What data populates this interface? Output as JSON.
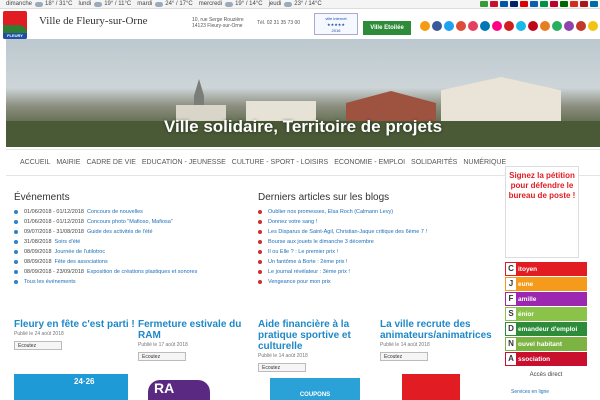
{
  "weather": [
    {
      "day": "dimanche",
      "temp": "18° / 31°C"
    },
    {
      "day": "lundi",
      "temp": "19° / 11°C"
    },
    {
      "day": "mardi",
      "temp": "24° / 17°C"
    },
    {
      "day": "mercredi",
      "temp": "19° / 14°C"
    },
    {
      "day": "jeudi",
      "temp": "23° / 14°C"
    }
  ],
  "header": {
    "logo_text": "FLEURY",
    "title": "Ville de Fleury-sur-Orne",
    "address_line1": "10, rue Serge Rouzière",
    "address_line2": "14123 Fleury-sur-Orne",
    "phone": "Tél. 02 31 35 73 00",
    "ville_internet_label": "ville internet",
    "ville_internet_stars": "★★★★★",
    "ville_internet_year": "2016",
    "ville_etoilee": "Ville Etoilée"
  },
  "banner": {
    "text": "Ville solidaire, Territoire de projets"
  },
  "nav": [
    "ACCUEIL",
    "MAIRIE",
    "CADRE DE VIE",
    "EDUCATION - JEUNESSE",
    "CULTURE - SPORT - LOISIRS",
    "ECONOMIE - EMPLOI",
    "SOLIDARITÉS",
    "NUMÉRIQUE"
  ],
  "events": {
    "title": "Événements",
    "items": [
      {
        "date": "01/06/2018 - 01/12/2018",
        "title": "Concours de nouvelles"
      },
      {
        "date": "01/06/2018 - 01/12/2018",
        "title": "Concours photo \"Mafioso, Mafiosa\""
      },
      {
        "date": "09/07/2018 - 31/08/2018",
        "title": "Guide des activités de l'été"
      },
      {
        "date": "31/08/2018",
        "title": "Soirs d'été"
      },
      {
        "date": "08/09/2018",
        "title": "Journée de l'utilotroc"
      },
      {
        "date": "08/09/2018",
        "title": "Fête des associations"
      },
      {
        "date": "08/09/2018 - 23/09/2018",
        "title": "Exposition de créations plastiques et sonores"
      },
      {
        "date": "",
        "title": "Tous les événements"
      }
    ]
  },
  "blogs": {
    "title": "Derniers articles sur les blogs",
    "items": [
      "Oublier nos promesses, Elsa Roch (Calmann Levy)",
      "Donnez votre sang !",
      "Les Disparus de Saint-Agil, Christian-Jaque critique des 6ème 7 !",
      "Bourse aux jouets le dimanche 3 décembre",
      "Il ou Elle ? : Le premier prix !",
      "Un fantôme à Borte : 2ème prix !",
      "Le journal révélateur : 3ème prix !",
      "Vengeance pour mon prix"
    ]
  },
  "petition": "Signez la pétition pour défendre le bureau de poste !",
  "citoyen": [
    {
      "letter": "C",
      "label": "itoyen",
      "color": "#e21c23"
    },
    {
      "letter": "J",
      "label": "eune",
      "color": "#f59a1a"
    },
    {
      "letter": "F",
      "label": "amille",
      "color": "#9c27b0"
    },
    {
      "letter": "S",
      "label": "énior",
      "color": "#8bc34a"
    },
    {
      "letter": "D",
      "label": "emandeur d'emploi",
      "color": "#2e8b3a"
    },
    {
      "letter": "N",
      "label": "ouvel habitant",
      "color": "#7cb342"
    },
    {
      "letter": "A",
      "label": "ssociation",
      "color": "#c8102e"
    }
  ],
  "acces_direct": "Accès direct",
  "services_link": "Services en ligne",
  "cards": [
    {
      "title": "Fleury en fête c'est parti !",
      "date": "Publié le 24 août 2018",
      "listen": "Ecoutez"
    },
    {
      "title": "Fermeture estivale du RAM",
      "date": "Publié le 17 août 2018",
      "listen": "Ecoutez"
    },
    {
      "title": "Aide financière à la pratique sportive et culturelle",
      "date": "Publié le 14 août 2018",
      "listen": "Ecoutez"
    },
    {
      "title": "La ville recrute des animateurs/animatrices",
      "date": "Publié le 14 août 2018",
      "listen": "Ecoutez"
    }
  ],
  "thumbs": {
    "fete_date": "24·26",
    "ram_text": "RA",
    "coupons": "COUPONS"
  }
}
